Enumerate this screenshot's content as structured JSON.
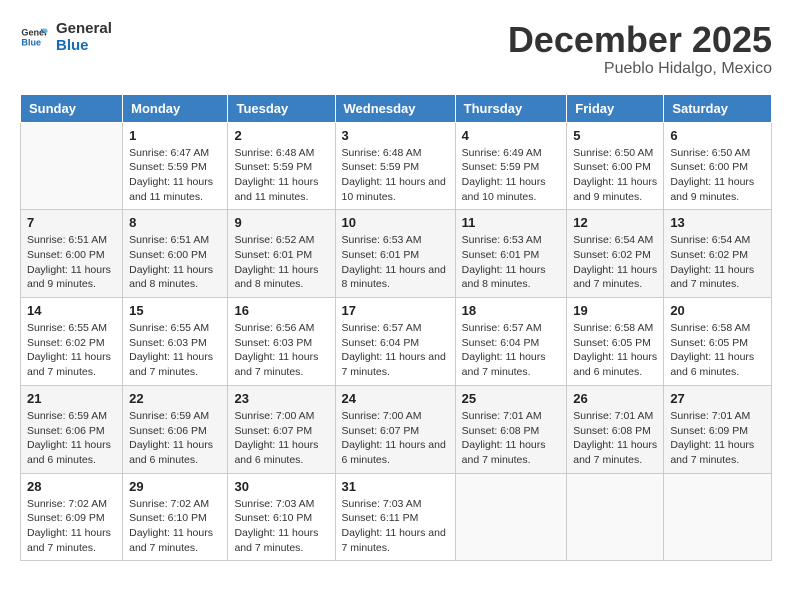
{
  "header": {
    "logo_line1": "General",
    "logo_line2": "Blue",
    "month": "December 2025",
    "location": "Pueblo Hidalgo, Mexico"
  },
  "days_of_week": [
    "Sunday",
    "Monday",
    "Tuesday",
    "Wednesday",
    "Thursday",
    "Friday",
    "Saturday"
  ],
  "weeks": [
    [
      {
        "day": "",
        "sunrise": "",
        "sunset": "",
        "daylight": ""
      },
      {
        "day": "1",
        "sunrise": "6:47 AM",
        "sunset": "5:59 PM",
        "daylight": "11 hours and 11 minutes."
      },
      {
        "day": "2",
        "sunrise": "6:48 AM",
        "sunset": "5:59 PM",
        "daylight": "11 hours and 11 minutes."
      },
      {
        "day": "3",
        "sunrise": "6:48 AM",
        "sunset": "5:59 PM",
        "daylight": "11 hours and 10 minutes."
      },
      {
        "day": "4",
        "sunrise": "6:49 AM",
        "sunset": "5:59 PM",
        "daylight": "11 hours and 10 minutes."
      },
      {
        "day": "5",
        "sunrise": "6:50 AM",
        "sunset": "6:00 PM",
        "daylight": "11 hours and 9 minutes."
      },
      {
        "day": "6",
        "sunrise": "6:50 AM",
        "sunset": "6:00 PM",
        "daylight": "11 hours and 9 minutes."
      }
    ],
    [
      {
        "day": "7",
        "sunrise": "6:51 AM",
        "sunset": "6:00 PM",
        "daylight": "11 hours and 9 minutes."
      },
      {
        "day": "8",
        "sunrise": "6:51 AM",
        "sunset": "6:00 PM",
        "daylight": "11 hours and 8 minutes."
      },
      {
        "day": "9",
        "sunrise": "6:52 AM",
        "sunset": "6:01 PM",
        "daylight": "11 hours and 8 minutes."
      },
      {
        "day": "10",
        "sunrise": "6:53 AM",
        "sunset": "6:01 PM",
        "daylight": "11 hours and 8 minutes."
      },
      {
        "day": "11",
        "sunrise": "6:53 AM",
        "sunset": "6:01 PM",
        "daylight": "11 hours and 8 minutes."
      },
      {
        "day": "12",
        "sunrise": "6:54 AM",
        "sunset": "6:02 PM",
        "daylight": "11 hours and 7 minutes."
      },
      {
        "day": "13",
        "sunrise": "6:54 AM",
        "sunset": "6:02 PM",
        "daylight": "11 hours and 7 minutes."
      }
    ],
    [
      {
        "day": "14",
        "sunrise": "6:55 AM",
        "sunset": "6:02 PM",
        "daylight": "11 hours and 7 minutes."
      },
      {
        "day": "15",
        "sunrise": "6:55 AM",
        "sunset": "6:03 PM",
        "daylight": "11 hours and 7 minutes."
      },
      {
        "day": "16",
        "sunrise": "6:56 AM",
        "sunset": "6:03 PM",
        "daylight": "11 hours and 7 minutes."
      },
      {
        "day": "17",
        "sunrise": "6:57 AM",
        "sunset": "6:04 PM",
        "daylight": "11 hours and 7 minutes."
      },
      {
        "day": "18",
        "sunrise": "6:57 AM",
        "sunset": "6:04 PM",
        "daylight": "11 hours and 7 minutes."
      },
      {
        "day": "19",
        "sunrise": "6:58 AM",
        "sunset": "6:05 PM",
        "daylight": "11 hours and 6 minutes."
      },
      {
        "day": "20",
        "sunrise": "6:58 AM",
        "sunset": "6:05 PM",
        "daylight": "11 hours and 6 minutes."
      }
    ],
    [
      {
        "day": "21",
        "sunrise": "6:59 AM",
        "sunset": "6:06 PM",
        "daylight": "11 hours and 6 minutes."
      },
      {
        "day": "22",
        "sunrise": "6:59 AM",
        "sunset": "6:06 PM",
        "daylight": "11 hours and 6 minutes."
      },
      {
        "day": "23",
        "sunrise": "7:00 AM",
        "sunset": "6:07 PM",
        "daylight": "11 hours and 6 minutes."
      },
      {
        "day": "24",
        "sunrise": "7:00 AM",
        "sunset": "6:07 PM",
        "daylight": "11 hours and 6 minutes."
      },
      {
        "day": "25",
        "sunrise": "7:01 AM",
        "sunset": "6:08 PM",
        "daylight": "11 hours and 7 minutes."
      },
      {
        "day": "26",
        "sunrise": "7:01 AM",
        "sunset": "6:08 PM",
        "daylight": "11 hours and 7 minutes."
      },
      {
        "day": "27",
        "sunrise": "7:01 AM",
        "sunset": "6:09 PM",
        "daylight": "11 hours and 7 minutes."
      }
    ],
    [
      {
        "day": "28",
        "sunrise": "7:02 AM",
        "sunset": "6:09 PM",
        "daylight": "11 hours and 7 minutes."
      },
      {
        "day": "29",
        "sunrise": "7:02 AM",
        "sunset": "6:10 PM",
        "daylight": "11 hours and 7 minutes."
      },
      {
        "day": "30",
        "sunrise": "7:03 AM",
        "sunset": "6:10 PM",
        "daylight": "11 hours and 7 minutes."
      },
      {
        "day": "31",
        "sunrise": "7:03 AM",
        "sunset": "6:11 PM",
        "daylight": "11 hours and 7 minutes."
      },
      {
        "day": "",
        "sunrise": "",
        "sunset": "",
        "daylight": ""
      },
      {
        "day": "",
        "sunrise": "",
        "sunset": "",
        "daylight": ""
      },
      {
        "day": "",
        "sunrise": "",
        "sunset": "",
        "daylight": ""
      }
    ]
  ],
  "labels": {
    "sunrise": "Sunrise:",
    "sunset": "Sunset:",
    "daylight": "Daylight:"
  }
}
